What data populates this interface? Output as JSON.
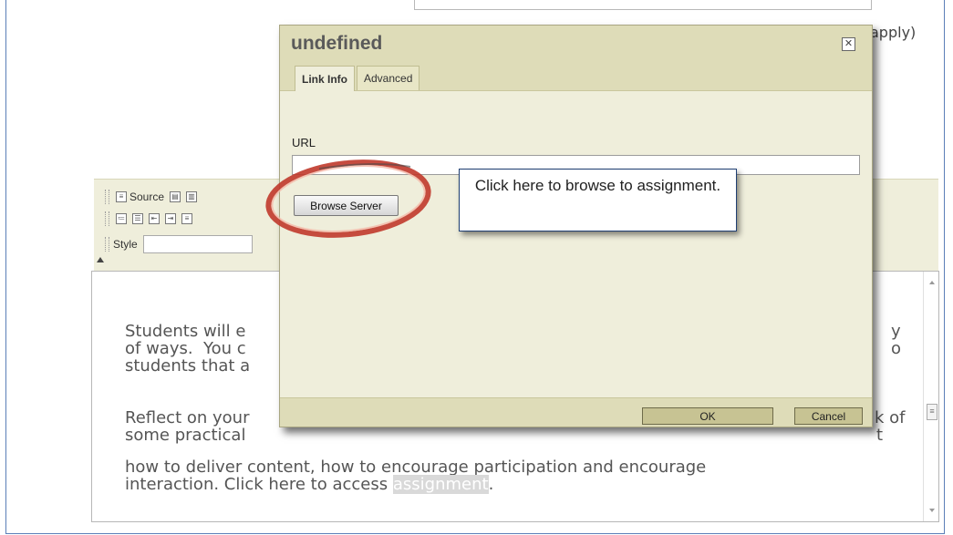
{
  "background": {
    "apply_text": "apply)"
  },
  "toolbar": {
    "source_label": "Source",
    "style_label": "Style"
  },
  "editor": {
    "line1": "Students will e",
    "line1_tail": "y",
    "line2": "of ways.  You c",
    "line2_tail": "o",
    "line3": "students that a",
    "line4": "Reflect on your",
    "line4_tail": "k of",
    "line5": "some practical ",
    "line5_tail": "t",
    "line6": "how to deliver content, how to encourage participation and encourage",
    "line7_pre": "interaction. Click here to access ",
    "line7_link": "assignment",
    "line7_post": "."
  },
  "dialog": {
    "title": "undefined",
    "tabs": [
      "Link Info",
      "Advanced"
    ],
    "url_label": "URL",
    "url_value": "",
    "browse_button": "Browse Server",
    "ok_button": "OK",
    "cancel_button": "Cancel"
  },
  "callout": {
    "text": "Click here to browse to assignment."
  },
  "colors": {
    "dialog_bg": "#efeedb",
    "dialog_header": "#dedcb8",
    "highlight_ring": "#c0392b",
    "frame_border": "#5b7fb8"
  }
}
